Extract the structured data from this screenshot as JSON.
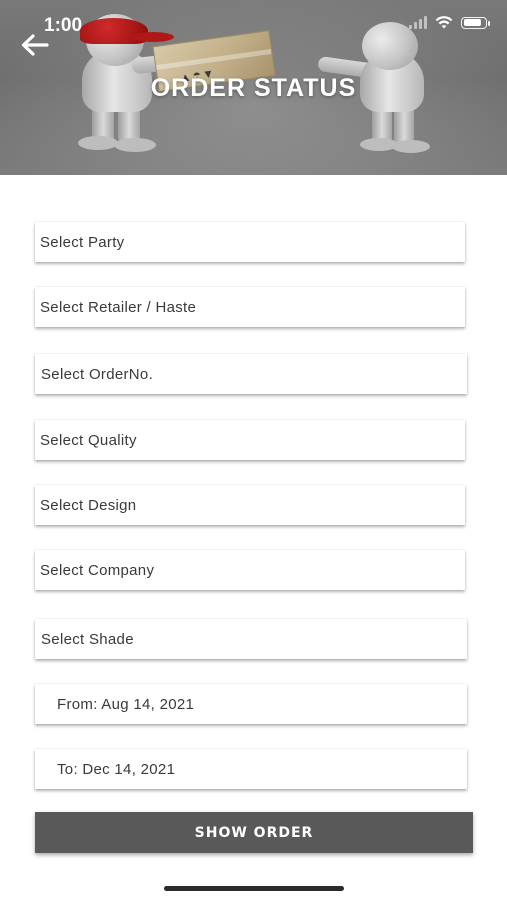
{
  "status_bar": {
    "time": "1:00",
    "wifi_icon": "wifi-icon",
    "battery_icon": "battery-icon",
    "battery_level": 0.85
  },
  "header": {
    "title": "ORDER STATUS",
    "back_icon": "arrow-left-icon",
    "banner_image": "delivery-figures-handing-package",
    "banner_color": "#7f7f7f",
    "cap_color": "#b01818"
  },
  "form": {
    "party": "Select Party",
    "retailer": "Select Retailer / Haste",
    "order_no": "Select OrderNo.",
    "quality": "Select Quality",
    "design": "Select Design",
    "company": "Select Company",
    "shade": "Select Shade",
    "from_date": "From: Aug 14, 2021",
    "to_date": "To: Dec 14, 2021"
  },
  "actions": {
    "show_order": "SHOW ORDER",
    "button_color": "#595959"
  }
}
